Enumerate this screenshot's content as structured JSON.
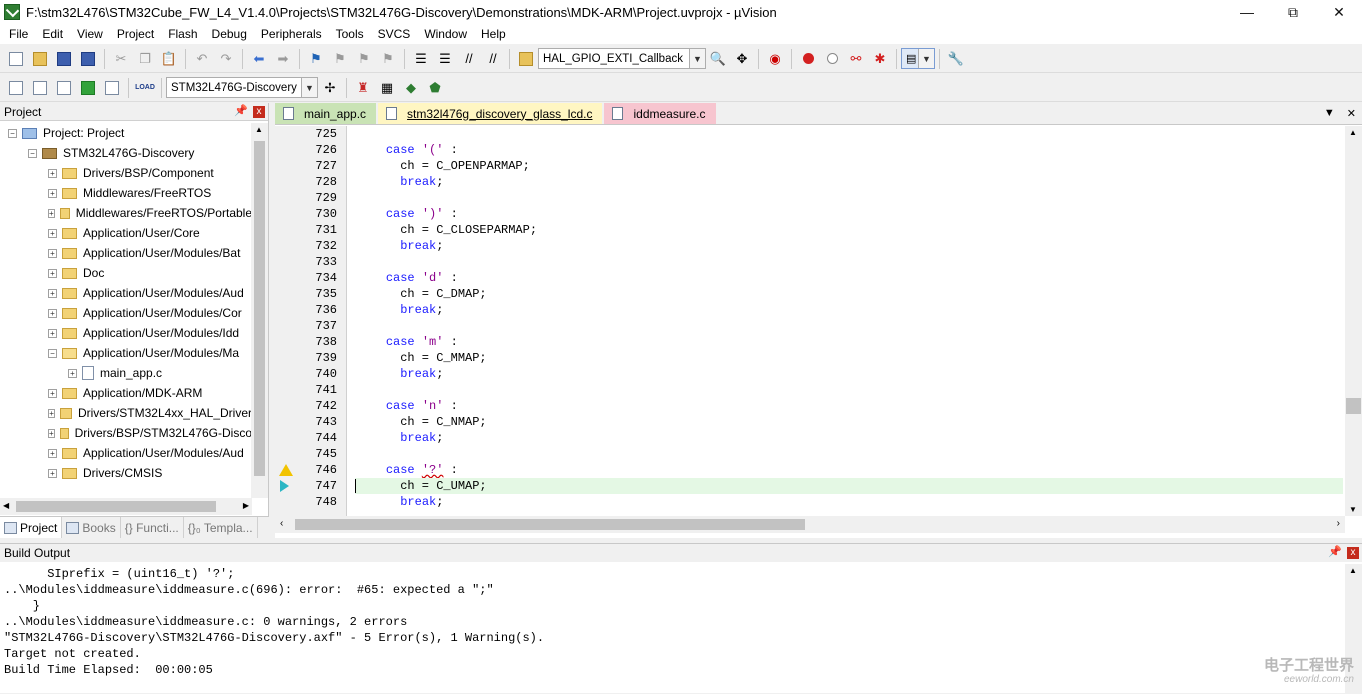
{
  "window": {
    "title": "F:\\stm32L476\\STM32Cube_FW_L4_V1.4.0\\Projects\\STM32L476G-Discovery\\Demonstrations\\MDK-ARM\\Project.uvprojx - µVision",
    "minimize": "—",
    "maximize": "⧉",
    "close": "✕"
  },
  "menu": [
    "File",
    "Edit",
    "View",
    "Project",
    "Flash",
    "Debug",
    "Peripherals",
    "Tools",
    "SVCS",
    "Window",
    "Help"
  ],
  "toolbar": {
    "find_combo": "HAL_GPIO_EXTI_Callback",
    "target_combo": "STM32L476G-Discovery",
    "load_label": "LOAD"
  },
  "project_pane": {
    "title": "Project",
    "pin": "⊞",
    "close": "x",
    "tree": [
      {
        "label": "Project: Project",
        "level": 0,
        "kind": "root",
        "expander": "−"
      },
      {
        "label": "STM32L476G-Discovery",
        "level": 1,
        "kind": "target",
        "expander": "−"
      },
      {
        "label": "Drivers/BSP/Component",
        "level": 2,
        "kind": "folder",
        "expander": "+"
      },
      {
        "label": "Middlewares/FreeRTOS",
        "level": 2,
        "kind": "folder",
        "expander": "+"
      },
      {
        "label": "Middlewares/FreeRTOS/Portable",
        "level": 2,
        "kind": "folder",
        "expander": "+"
      },
      {
        "label": "Application/User/Core",
        "level": 2,
        "kind": "folder",
        "expander": "+"
      },
      {
        "label": "Application/User/Modules/Bat",
        "level": 2,
        "kind": "folder",
        "expander": "+"
      },
      {
        "label": "Doc",
        "level": 2,
        "kind": "folder",
        "expander": "+"
      },
      {
        "label": "Application/User/Modules/Aud",
        "level": 2,
        "kind": "folder",
        "expander": "+"
      },
      {
        "label": "Application/User/Modules/Cor",
        "level": 2,
        "kind": "folder",
        "expander": "+"
      },
      {
        "label": "Application/User/Modules/Idd",
        "level": 2,
        "kind": "folder",
        "expander": "+"
      },
      {
        "label": "Application/User/Modules/Ma",
        "level": 2,
        "kind": "folder-open",
        "expander": "−"
      },
      {
        "label": "main_app.c",
        "level": 3,
        "kind": "file",
        "expander": "+"
      },
      {
        "label": "Application/MDK-ARM",
        "level": 2,
        "kind": "folder",
        "expander": "+"
      },
      {
        "label": "Drivers/STM32L4xx_HAL_Driver",
        "level": 2,
        "kind": "folder",
        "expander": "+"
      },
      {
        "label": "Drivers/BSP/STM32L476G-Disco",
        "level": 2,
        "kind": "folder",
        "expander": "+"
      },
      {
        "label": "Application/User/Modules/Aud",
        "level": 2,
        "kind": "folder",
        "expander": "+"
      },
      {
        "label": "Drivers/CMSIS",
        "level": 2,
        "kind": "folder",
        "expander": "+"
      }
    ],
    "tabs": [
      "Project",
      "Books",
      "{} Functi...",
      "{}₀ Templa..."
    ]
  },
  "editor": {
    "tabs": [
      "main_app.c",
      "stm32l476g_discovery_glass_lcd.c",
      "iddmeasure.c"
    ],
    "active_tab": 1,
    "lines": [
      {
        "no": "725",
        "code": ""
      },
      {
        "no": "726",
        "code": "    case '(' :"
      },
      {
        "no": "727",
        "code": "      ch = C_OPENPARMAP;"
      },
      {
        "no": "728",
        "code": "      break;"
      },
      {
        "no": "729",
        "code": ""
      },
      {
        "no": "730",
        "code": "    case ')' :"
      },
      {
        "no": "731",
        "code": "      ch = C_CLOSEPARMAP;"
      },
      {
        "no": "732",
        "code": "      break;"
      },
      {
        "no": "733",
        "code": ""
      },
      {
        "no": "734",
        "code": "    case 'd' :"
      },
      {
        "no": "735",
        "code": "      ch = C_DMAP;"
      },
      {
        "no": "736",
        "code": "      break;"
      },
      {
        "no": "737",
        "code": ""
      },
      {
        "no": "738",
        "code": "    case 'm' :"
      },
      {
        "no": "739",
        "code": "      ch = C_MMAP;"
      },
      {
        "no": "740",
        "code": "      break;"
      },
      {
        "no": "741",
        "code": ""
      },
      {
        "no": "742",
        "code": "    case 'n' :"
      },
      {
        "no": "743",
        "code": "      ch = C_NMAP;"
      },
      {
        "no": "744",
        "code": "      break;"
      },
      {
        "no": "745",
        "code": ""
      },
      {
        "no": "746",
        "code": "    case '?' :",
        "marker": "warning"
      },
      {
        "no": "747",
        "code": "      ch = C_UMAP;",
        "marker": "current",
        "highlight": true
      },
      {
        "no": "748",
        "code": "      break;"
      }
    ]
  },
  "build_output": {
    "title": "Build Output",
    "lines": [
      "      SIprefix = (uint16_t) '?';",
      "..\\Modules\\iddmeasure\\iddmeasure.c(696): error:  #65: expected a \";\"",
      "    }",
      "..\\Modules\\iddmeasure\\iddmeasure.c: 0 warnings, 2 errors",
      "\"STM32L476G-Discovery\\STM32L476G-Discovery.axf\" - 5 Error(s), 1 Warning(s).",
      "Target not created.",
      "Build Time Elapsed:  00:00:05"
    ]
  },
  "watermark": {
    "line1": "电子工程世界",
    "line2": "eeworld.com.cn"
  }
}
